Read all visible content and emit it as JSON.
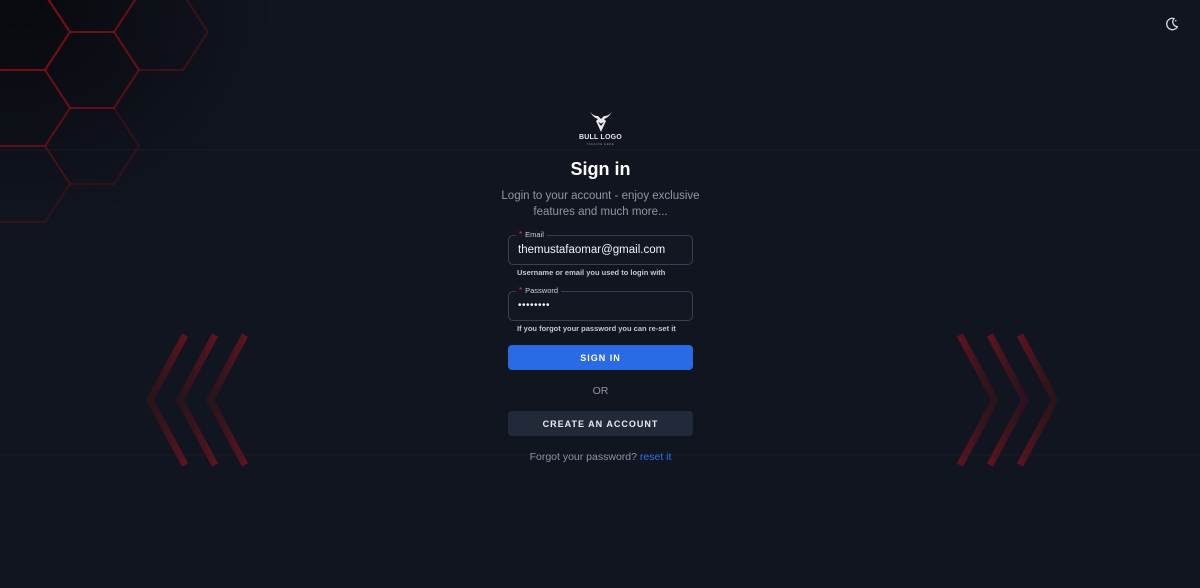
{
  "theme_toggle": {
    "icon": "moon-icon"
  },
  "logo": {
    "text": "BULL LOGO",
    "subtext": "TAGLINE HERE",
    "icon": "bull-head-icon"
  },
  "header": {
    "title": "Sign in",
    "subtitle": "Login to your account - enjoy exclusive features and much more..."
  },
  "form": {
    "email": {
      "label": "Email",
      "required_marker": "*",
      "value": "themustafaomar@gmail.com",
      "helper": "Username or email you used to login with"
    },
    "password": {
      "label": "Password",
      "required_marker": "*",
      "value": "••••••••",
      "helper": "If you forgot your password you can re-set it"
    },
    "sign_in_label": "SIGN IN",
    "or_label": "OR",
    "create_account_label": "CREATE AN ACCOUNT",
    "forgot_text": "Forgot your password?",
    "reset_link": "reset it"
  },
  "colors": {
    "background": "#11151f",
    "primary": "#2a6ae4",
    "secondary_button": "#222a3a",
    "accent_red": "#b3121c",
    "link": "#2f73f0"
  }
}
